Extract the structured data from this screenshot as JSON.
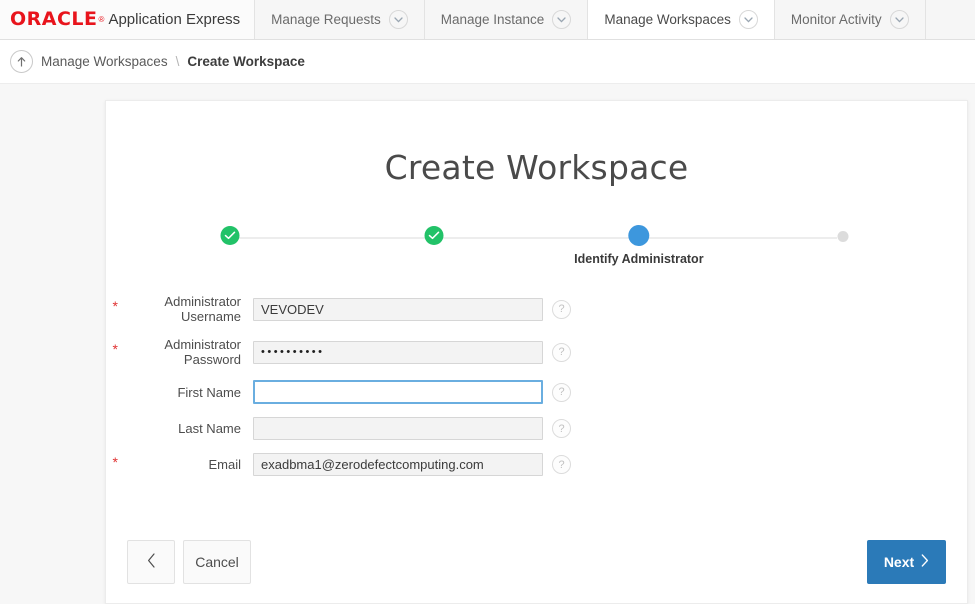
{
  "header": {
    "brand_oracle": "ORACLE",
    "brand_reg": "®",
    "brand_app": "Application Express",
    "tabs": [
      {
        "label": "Manage Requests",
        "active": false
      },
      {
        "label": "Manage Instance",
        "active": false
      },
      {
        "label": "Manage Workspaces",
        "active": true
      },
      {
        "label": "Monitor Activity",
        "active": false
      }
    ]
  },
  "breadcrumb": {
    "up_icon": "up-arrow-circle-icon",
    "parent": "Manage Workspaces",
    "separator": "\\",
    "current": "Create Workspace"
  },
  "card": {
    "title": "Create Workspace",
    "steps": {
      "items": [
        {
          "state": "done",
          "label": ""
        },
        {
          "state": "done",
          "label": ""
        },
        {
          "state": "current",
          "label": "Identify Administrator"
        },
        {
          "state": "pending",
          "label": ""
        }
      ],
      "colors": {
        "done": "#22c268",
        "current": "#3d97dd",
        "pending": "#dcdcdc",
        "line": "#ededed"
      }
    },
    "form": {
      "required_marker": "*",
      "help_icon": "?",
      "fields": [
        {
          "name": "administrator-username",
          "label": "Administrator Username",
          "required": true,
          "value": "VEVODEV",
          "placeholder": "",
          "focused": false,
          "type": "text"
        },
        {
          "name": "administrator-password",
          "label": "Administrator Password",
          "required": true,
          "value": "••••••••••",
          "placeholder": "",
          "focused": false,
          "type": "password"
        },
        {
          "name": "first-name",
          "label": "First Name",
          "required": false,
          "value": "",
          "placeholder": "",
          "focused": true,
          "type": "text"
        },
        {
          "name": "last-name",
          "label": "Last Name",
          "required": false,
          "value": "",
          "placeholder": "",
          "focused": false,
          "type": "text"
        },
        {
          "name": "email",
          "label": "Email",
          "required": true,
          "value": "exadbma1@zerodefectcomputing.com",
          "placeholder": "",
          "focused": false,
          "type": "text"
        }
      ]
    },
    "footer": {
      "back_label": "",
      "cancel_label": "Cancel",
      "next_label": "Next",
      "next_color": "#2b7ab8"
    }
  }
}
